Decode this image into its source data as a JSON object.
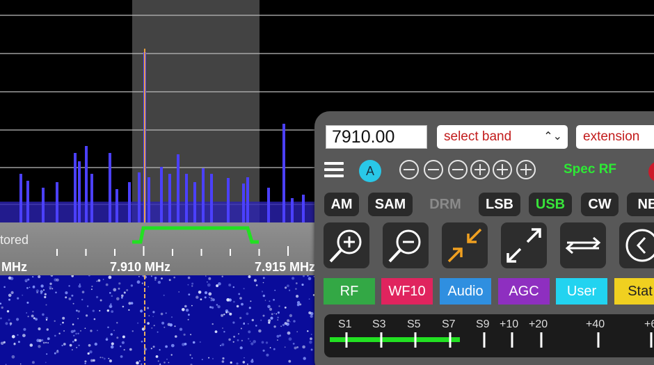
{
  "scale": {
    "stored_label": "tored",
    "freq_left": "MHz",
    "freq_center": "7.910 MHz",
    "freq_right": "7.915 MHz"
  },
  "panel": {
    "frequency_value": "7910.00",
    "band_select": "select band",
    "extension_select": "extension",
    "receiver_badge": "A",
    "spec_rf": "Spec RF",
    "modes": [
      {
        "label": "AM",
        "state": "normal"
      },
      {
        "label": "SAM",
        "state": "normal"
      },
      {
        "label": "DRM",
        "state": "disabled"
      },
      {
        "label": "LSB",
        "state": "normal"
      },
      {
        "label": "USB",
        "state": "active"
      },
      {
        "label": "CW",
        "state": "normal"
      },
      {
        "label": "NB",
        "state": "normal"
      }
    ],
    "icon_buttons": [
      "zoom-in-icon",
      "zoom-out-icon",
      "compress-arrows-icon",
      "expand-arrows-icon",
      "swap-arrows-icon",
      "back-circle-icon"
    ],
    "tabs": [
      {
        "label": "RF",
        "color": "#33a845"
      },
      {
        "label": "WF10",
        "color": "#e0245e"
      },
      {
        "label": "Audio",
        "color": "#2f8fe0"
      },
      {
        "label": "AGC",
        "color": "#8e2fc0"
      },
      {
        "label": "User",
        "color": "#22d3f0"
      },
      {
        "label": "Stat",
        "color": "#f0d020"
      }
    ],
    "smeter": {
      "labels": [
        "S1",
        "S3",
        "S5",
        "S7",
        "S9",
        "+10",
        "+20",
        "+40",
        "+6"
      ],
      "level_fraction": 0.36
    }
  },
  "colors": {
    "panel_bg": "#585858",
    "passband": "#22e022",
    "spectrum_blue": "#3a2cf0",
    "active_mode": "#38e43a"
  }
}
